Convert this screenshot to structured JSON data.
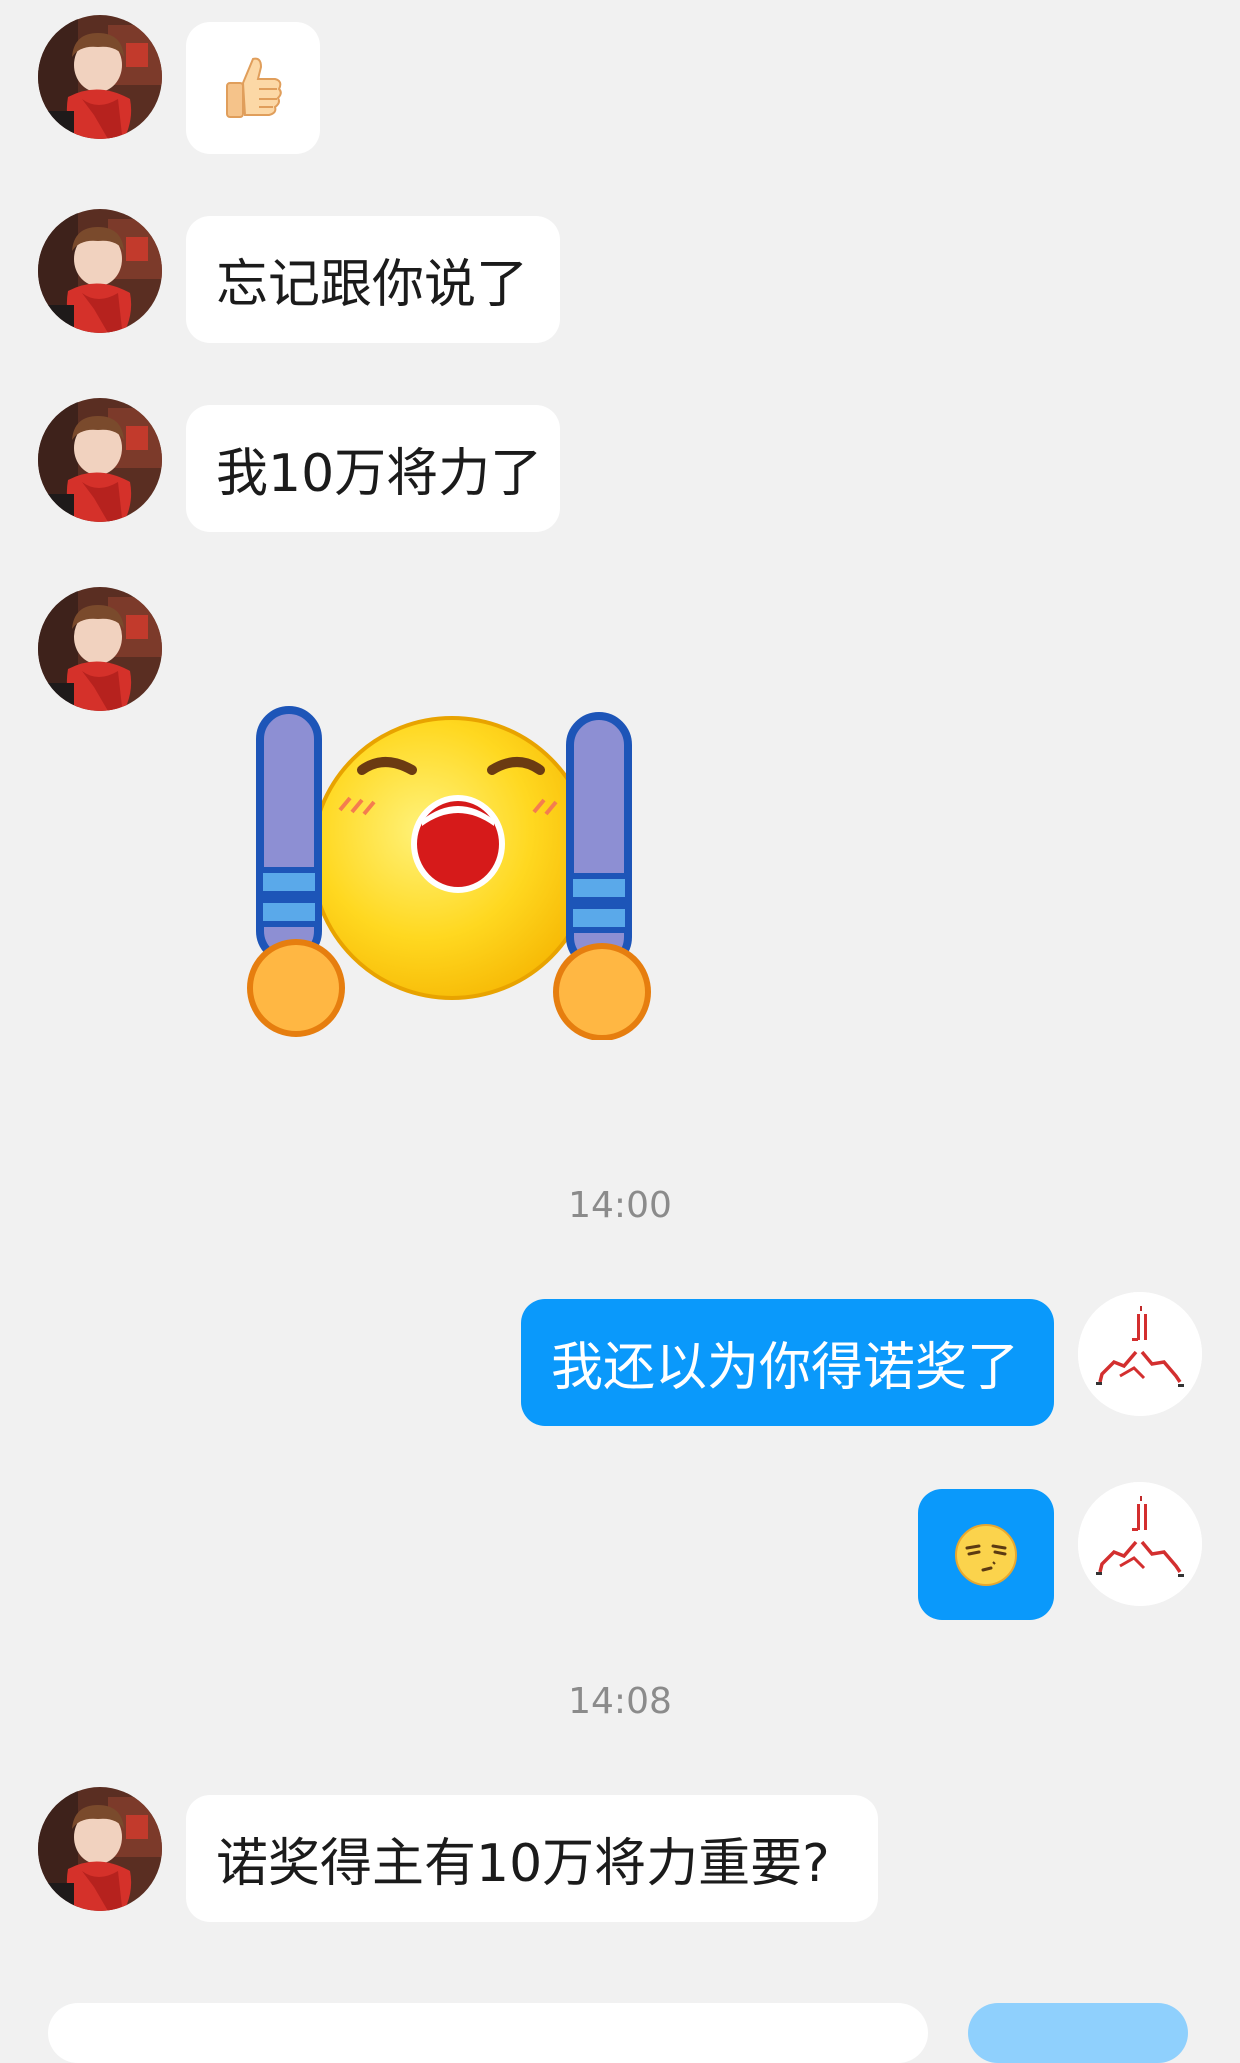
{
  "colors": {
    "background": "#f1f1f1",
    "incoming_bubble": "#ffffff",
    "outgoing_bubble": "#0a99fb",
    "timestamp_text": "#8b8b8b"
  },
  "messages": [
    {
      "sender": "contact",
      "type": "emoji",
      "icon": "thumbs-up-icon"
    },
    {
      "sender": "contact",
      "type": "text",
      "text": "忘记跟你说了"
    },
    {
      "sender": "contact",
      "type": "text",
      "text": "我10万将力了"
    },
    {
      "sender": "contact",
      "type": "sticker",
      "icon": "cheering-face-sticker"
    },
    {
      "type": "timestamp",
      "text": "14:00"
    },
    {
      "sender": "me",
      "type": "text",
      "text": "我还以为你得诺奖了"
    },
    {
      "sender": "me",
      "type": "emoji",
      "icon": "unamused-face-icon"
    },
    {
      "type": "timestamp",
      "text": "14:08"
    },
    {
      "sender": "contact",
      "type": "text",
      "text": "诺奖得主有10万将力重要?"
    }
  ]
}
